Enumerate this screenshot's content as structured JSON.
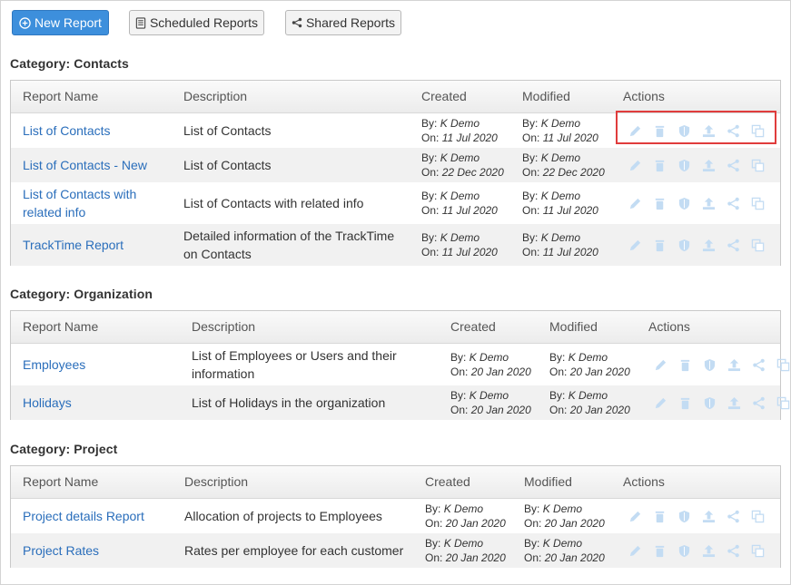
{
  "toolbar": {
    "new_report": "New Report",
    "scheduled_reports": "Scheduled Reports",
    "shared_reports": "Shared Reports"
  },
  "categories": [
    {
      "label": "Category: Contacts",
      "headers": {
        "name": "Report Name",
        "description": "Description",
        "created": "Created",
        "modified": "Modified",
        "actions": "Actions"
      },
      "rows": [
        {
          "name": [
            "List of Contacts"
          ],
          "description": [
            "List of Contacts"
          ],
          "created_by": "K Demo",
          "created_on": "11 Jul 2020",
          "modified_by": "K Demo",
          "modified_on": "11 Jul 2020"
        },
        {
          "name": [
            "List of Contacts - New"
          ],
          "description": [
            "List of Contacts"
          ],
          "created_by": "K Demo",
          "created_on": "22 Dec 2020",
          "modified_by": "K Demo",
          "modified_on": "22 Dec 2020"
        },
        {
          "name": [
            "List of Contacts with",
            "related info"
          ],
          "description": [
            "List of Contacts with related info"
          ],
          "created_by": "K Demo",
          "created_on": "11 Jul 2020",
          "modified_by": "K Demo",
          "modified_on": "11 Jul 2020"
        },
        {
          "name": [
            "TrackTime Report"
          ],
          "description": [
            "Detailed information of the TrackTime",
            "on Contacts"
          ],
          "created_by": "K Demo",
          "created_on": "11 Jul 2020",
          "modified_by": "K Demo",
          "modified_on": "11 Jul 2020"
        }
      ]
    },
    {
      "label": "Category: Organization",
      "headers": {
        "name": "Report Name",
        "description": "Description",
        "created": "Created",
        "modified": "Modified",
        "actions": "Actions"
      },
      "rows": [
        {
          "name": [
            "Employees"
          ],
          "description": [
            "List of Employees or Users and their",
            "information"
          ],
          "created_by": "K Demo",
          "created_on": "20 Jan 2020",
          "modified_by": "K Demo",
          "modified_on": "20 Jan 2020"
        },
        {
          "name": [
            "Holidays"
          ],
          "description": [
            "List of Holidays in the organization"
          ],
          "created_by": "K Demo",
          "created_on": "20 Jan 2020",
          "modified_by": "K Demo",
          "modified_on": "20 Jan 2020"
        }
      ]
    },
    {
      "label": "Category: Project",
      "headers": {
        "name": "Report Name",
        "description": "Description",
        "created": "Created",
        "modified": "Modified",
        "actions": "Actions"
      },
      "rows": [
        {
          "name": [
            "Project details Report"
          ],
          "description": [
            "Allocation of projects to Employees"
          ],
          "created_by": "K Demo",
          "created_on": "20 Jan 2020",
          "modified_by": "K Demo",
          "modified_on": "20 Jan 2020"
        },
        {
          "name": [
            "Project Rates"
          ],
          "description": [
            "Rates per employee for each customer"
          ],
          "created_by": "K Demo",
          "created_on": "20 Jan 2020",
          "modified_by": "K Demo",
          "modified_on": "20 Jan 2020"
        }
      ]
    }
  ],
  "meta_labels": {
    "by": "By:",
    "on": "On:"
  },
  "action_icons": [
    "pencil-icon",
    "trash-icon",
    "shield-icon",
    "upload-icon",
    "share-icon",
    "copy-icon"
  ],
  "colors": {
    "primary": "#3d8fdc",
    "link": "#2a6ebb",
    "icon": "#c3dcf3",
    "highlight": "#e03c3c"
  }
}
